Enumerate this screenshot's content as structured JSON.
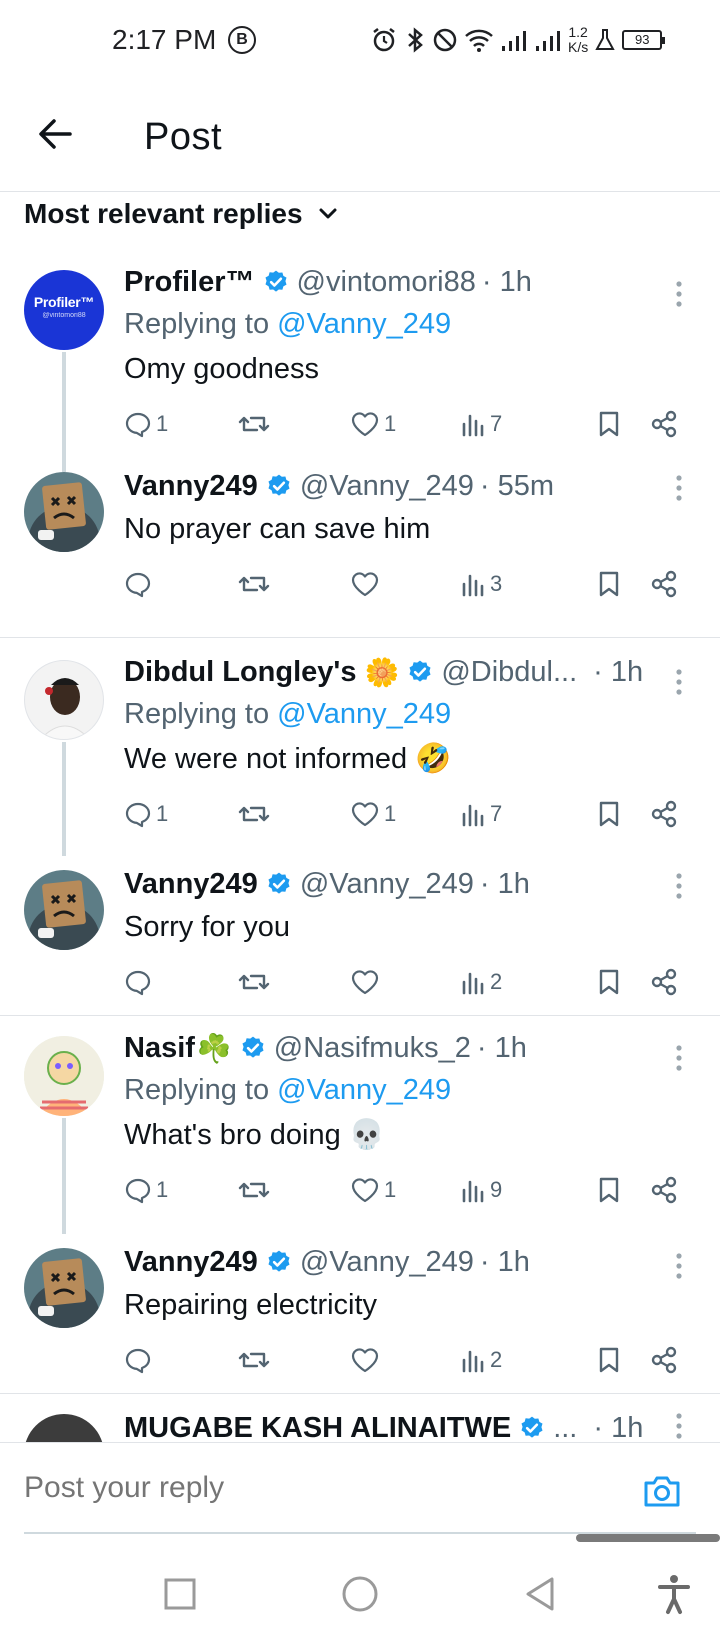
{
  "status_bar": {
    "time": "2:17 PM",
    "b_badge": "B",
    "net_speed_value": "1.2",
    "net_speed_unit": "K/s",
    "battery": "93",
    "icons": [
      "alarm-icon",
      "bluetooth-icon",
      "do-not-disturb-icon",
      "wifi-icon",
      "signal-icon",
      "signal-icon",
      "flask-icon"
    ]
  },
  "header": {
    "title": "Post",
    "back_icon": "arrow-left-icon"
  },
  "sort": {
    "label": "Most relevant replies",
    "icon": "chevron-down-icon"
  },
  "replies": [
    {
      "author": "Profiler™",
      "handle": "@vintomori88",
      "time": "· 1h",
      "replying_prefix": "Replying to",
      "replying_to": "@Vanny_249",
      "text": "Omy goodness",
      "replies": "1",
      "reposts": "",
      "likes": "1",
      "views": "7",
      "avatar_text": "Profiler™"
    },
    {
      "author": "Vanny249",
      "handle": "@Vanny_249",
      "time": "· 55m",
      "text": "No prayer can save him",
      "replies": "",
      "reposts": "",
      "likes": "",
      "views": "3"
    },
    {
      "author": "Dibdul Longley's",
      "author_emoji": "🌼",
      "handle": "@Dibdul...",
      "time": "· 1h",
      "replying_prefix": "Replying to",
      "replying_to": "@Vanny_249",
      "text": "We were not informed",
      "text_emoji": "🤣",
      "replies": "1",
      "reposts": "",
      "likes": "1",
      "views": "7"
    },
    {
      "author": "Vanny249",
      "handle": "@Vanny_249",
      "time": "· 1h",
      "text": "Sorry for you",
      "replies": "",
      "reposts": "",
      "likes": "",
      "views": "2"
    },
    {
      "author": "Nasif",
      "author_emoji": "☘️",
      "handle": "@Nasifmuks_2",
      "time": "· 1h",
      "replying_prefix": "Replying to",
      "replying_to": "@Vanny_249",
      "text": "What's bro doing",
      "text_emoji": "💀",
      "replies": "1",
      "reposts": "",
      "likes": "1",
      "views": "9"
    },
    {
      "author": "Vanny249",
      "handle": "@Vanny_249",
      "time": "· 1h",
      "text": "Repairing electricity",
      "replies": "",
      "reposts": "",
      "likes": "",
      "views": "2"
    },
    {
      "author": "MUGABE KASH ALINAITWE",
      "handle": "...",
      "time": "· 1h"
    }
  ],
  "composer": {
    "placeholder": "Post your reply",
    "camera_icon": "camera-icon"
  },
  "navbar": {
    "icons": [
      "recents-square-icon",
      "home-circle-icon",
      "back-triangle-icon",
      "accessibility-icon"
    ]
  },
  "colors": {
    "accent": "#1d9bf0",
    "secondary_text": "#536471",
    "verified": "#1d9bf0",
    "profiler_bg": "#1a35d6"
  }
}
